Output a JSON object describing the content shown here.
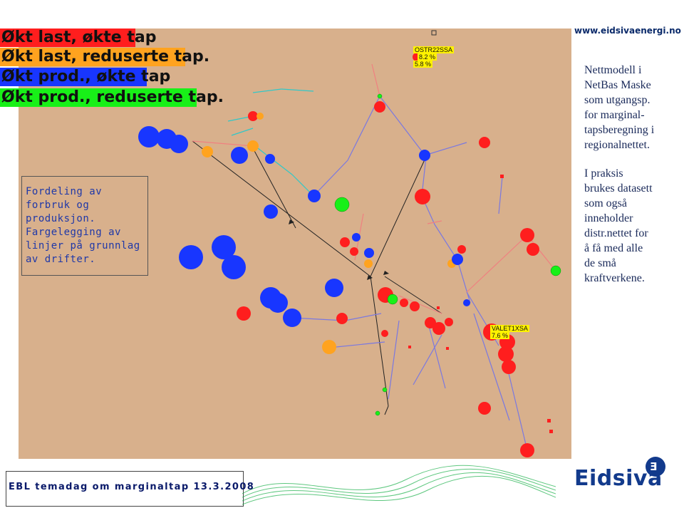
{
  "legend": {
    "red": "Økt last, økte tap",
    "orange": "Økt last, reduserte tap.",
    "blue": "Økt prod., økte tap",
    "green": "Økt prod., reduserte tap."
  },
  "infobox": {
    "lines": [
      "Fordeling av",
      "forbruk og",
      "produksjon.",
      "Fargelegging av",
      "linjer på grunnlag",
      "av drifter."
    ]
  },
  "map_labels": {
    "station1_name": "OSTR22SSA",
    "station1_pct1": "8.2 %",
    "station1_pct2": "5.8 %",
    "station2_name": "VALET1XSA",
    "station2_pct": "7.6 %"
  },
  "side_text": {
    "url": "www.eidsivaenergi.no",
    "p1": [
      "Nettmodell i",
      "NetBas Maske",
      "som utgangsp.",
      "for marginal-",
      "tapsberegning i",
      "regionalnettet."
    ],
    "p2": [
      "I praksis",
      "brukes datasett",
      "som også",
      "inneholder",
      "distr.nettet for",
      "å få med alle",
      "de små",
      "kraftverkene."
    ]
  },
  "footer": {
    "text": "EBL temadag om marginaltap 13.3.2008"
  },
  "brand": {
    "name": "Eidsiva",
    "logo_glyph": "Ǝ"
  },
  "colors": {
    "red": "#ff1e1e",
    "orange": "#ffa31f",
    "blue": "#1836ff",
    "green": "#18f018",
    "map_bg": "#d8b08c"
  }
}
